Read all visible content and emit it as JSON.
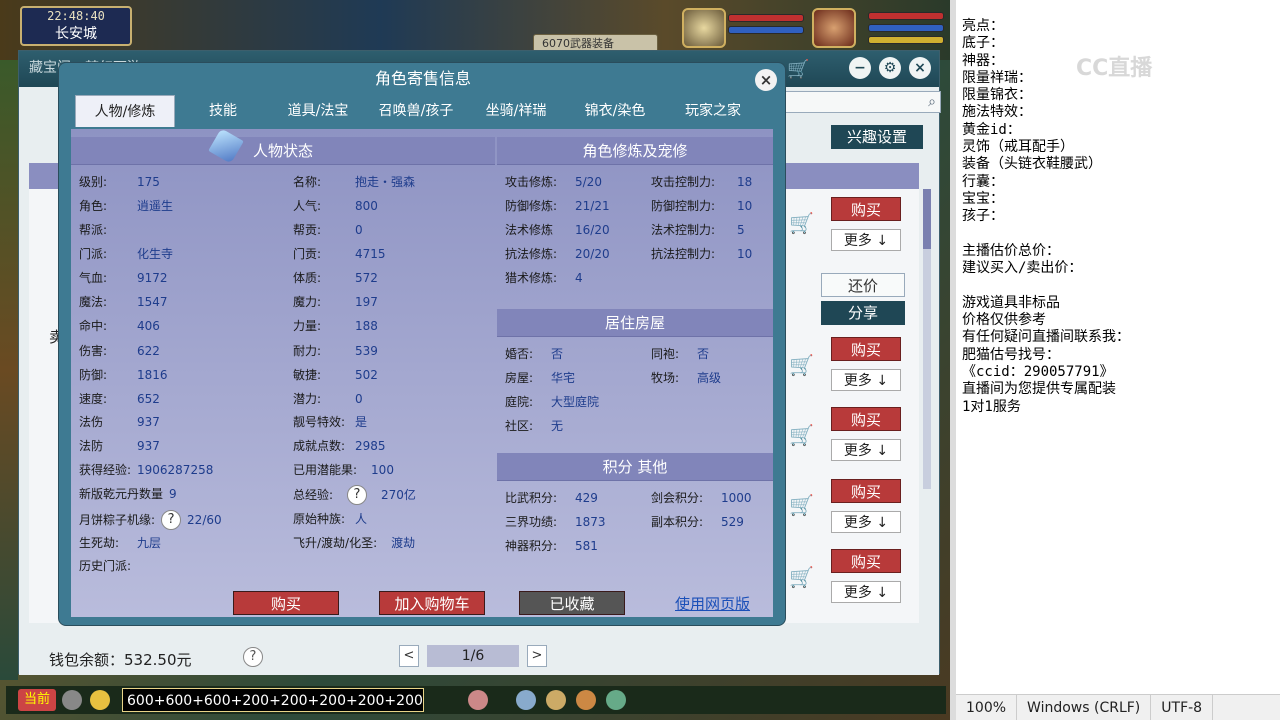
{
  "game": {
    "time": "22:48:40",
    "city": "长安城",
    "tag_bar": "6070武器装备"
  },
  "outer_window": {
    "title": "藏宝阁 - 梦幻西游",
    "interest_button": "兴趣设置",
    "counter_button": "还价",
    "share_button": "分享",
    "list_left_fragment": "卖",
    "buy_label": "购买",
    "more_label": "更多 ↓",
    "wallet": "钱包余额：532.50元",
    "help": "?",
    "page": "1/6",
    "prev": "<",
    "next": ">"
  },
  "modal": {
    "title": "角色寄售信息",
    "close": "×",
    "tabs": [
      "人物/修炼",
      "技能",
      "道具/法宝",
      "召唤兽/孩子",
      "坐骑/祥瑞",
      "锦衣/染色",
      "玩家之家"
    ],
    "status_header": "人物状态",
    "status_left": [
      {
        "k": "级别:",
        "v": "175"
      },
      {
        "k": "角色:",
        "v": "逍遥生"
      },
      {
        "k": "帮派:",
        "v": ""
      },
      {
        "k": "门派:",
        "v": "化生寺"
      },
      {
        "k": "气血:",
        "v": "9172"
      },
      {
        "k": "魔法:",
        "v": "1547"
      },
      {
        "k": "命中:",
        "v": "406"
      },
      {
        "k": "伤害:",
        "v": "622"
      },
      {
        "k": "防御:",
        "v": "1816"
      },
      {
        "k": "速度:",
        "v": "652"
      },
      {
        "k": "法伤",
        "v": "937"
      },
      {
        "k": "法防",
        "v": "937"
      },
      {
        "k": "获得经验:",
        "v": "1906287258"
      },
      {
        "k": "新版乾元丹数量",
        "v": "9"
      },
      {
        "k": "月饼粽子机缘:",
        "v": "22/60"
      },
      {
        "k": "生死劫:",
        "v": "九层"
      },
      {
        "k": "历史门派:",
        "v": ""
      }
    ],
    "status_right": [
      {
        "k": "名称:",
        "v": "抱走・强森"
      },
      {
        "k": "人气:",
        "v": "800"
      },
      {
        "k": "帮贡:",
        "v": "0"
      },
      {
        "k": "门贡:",
        "v": "4715"
      },
      {
        "k": "体质:",
        "v": "572"
      },
      {
        "k": "魔力:",
        "v": "197"
      },
      {
        "k": "力量:",
        "v": "188"
      },
      {
        "k": "耐力:",
        "v": "539"
      },
      {
        "k": "敏捷:",
        "v": "502"
      },
      {
        "k": "潜力:",
        "v": "0"
      },
      {
        "k": "靓号特效:",
        "v": "是"
      },
      {
        "k": "成就点数:",
        "v": "2985"
      },
      {
        "k": "已用潜能果:",
        "v": "100"
      },
      {
        "k": "总经验:",
        "v": "270亿"
      },
      {
        "k": "原始种族:",
        "v": "人"
      },
      {
        "k": "飞升/渡劫/化圣:",
        "v": "渡劫"
      }
    ],
    "cultivation_header": "角色修炼及宠修",
    "cultivation_left": [
      {
        "k": "攻击修炼:",
        "v": "5/20"
      },
      {
        "k": "防御修炼:",
        "v": "21/21"
      },
      {
        "k": "法术修炼",
        "v": "16/20"
      },
      {
        "k": "抗法修炼:",
        "v": "20/20"
      },
      {
        "k": "猎术修炼:",
        "v": "4"
      }
    ],
    "cultivation_right": [
      {
        "k": "攻击控制力:",
        "v": "18"
      },
      {
        "k": "防御控制力:",
        "v": "10"
      },
      {
        "k": "法术控制力:",
        "v": "5"
      },
      {
        "k": "抗法控制力:",
        "v": "10"
      }
    ],
    "house_header": "居住房屋",
    "house_left": [
      {
        "k": "婚否:",
        "v": "否"
      },
      {
        "k": "房屋:",
        "v": "华宅"
      },
      {
        "k": "庭院:",
        "v": "大型庭院"
      },
      {
        "k": "社区:",
        "v": "无"
      }
    ],
    "house_right": [
      {
        "k": "同袍:",
        "v": "否"
      },
      {
        "k": "牧场:",
        "v": "高级"
      }
    ],
    "points_header": "积分 其他",
    "points_left": [
      {
        "k": "比武积分:",
        "v": "429"
      },
      {
        "k": "三界功绩:",
        "v": "1873"
      },
      {
        "k": "神器积分:",
        "v": "581"
      }
    ],
    "points_right": [
      {
        "k": "剑会积分:",
        "v": "1000"
      },
      {
        "k": "副本积分:",
        "v": "529"
      }
    ],
    "help": "?",
    "buy": "购买",
    "add_cart": "加入购物车",
    "collected": "已收藏",
    "web_link": "使用网页版"
  },
  "chat": {
    "now_tag": "当前",
    "input": "600+600+600+200+200+200+200+200"
  },
  "notepad": {
    "lines": [
      "亮点：",
      "底子：",
      "神器：",
      "限量祥瑞：",
      "限量锦衣：",
      "施法特效：",
      "黄金id：",
      "灵饰（戒耳配手）",
      "装备（头链衣鞋腰武）",
      "行囊：",
      "宝宝：",
      "孩子：",
      "",
      "主播估价总价：",
      "建议买入/卖出价：",
      "",
      "游戏道具非标品",
      "价格仅供参考",
      "有任何疑问直播间联系我：",
      "肥猫估号找号：",
      "《ccid：290057791》",
      "直播间为您提供专属配装",
      "1对1服务"
    ],
    "watermark": "CC直播",
    "status": {
      "zoom": "100%",
      "eol": "Windows (CRLF)",
      "encoding": "UTF-8"
    }
  },
  "colors": {
    "modal_frame": "#3e7a92",
    "panel": "#8e93c3",
    "value_text": "#1e3c8c",
    "buy_red": "#b83a3a"
  }
}
